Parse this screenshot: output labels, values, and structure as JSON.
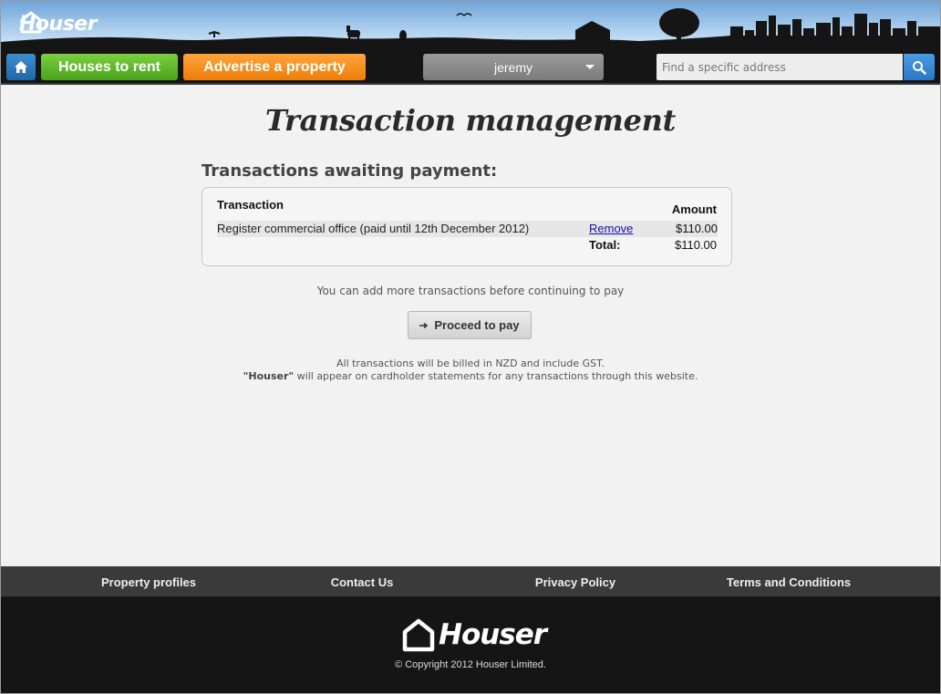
{
  "brand": {
    "name": "Houser"
  },
  "nav": {
    "houses_to_rent": "Houses to rent",
    "advertise": "Advertise a property",
    "user": "jeremy",
    "search_placeholder": "Find a specific address"
  },
  "page": {
    "title": "Transaction management",
    "section_title": "Transactions awaiting payment:"
  },
  "transactions": {
    "header_transaction": "Transaction",
    "header_amount": "Amount",
    "rows": [
      {
        "description": "Register commercial office (paid until 12th December 2012)",
        "action": "Remove",
        "amount": "$110.00"
      }
    ],
    "total_label": "Total:",
    "total_value": "$110.00"
  },
  "notes": {
    "add_more": "You can add more transactions before continuing to pay",
    "proceed": "Proceed to pay",
    "billing_line1": "All transactions will be billed in NZD and include GST.",
    "billing_brand": "\"Houser\"",
    "billing_line2": "will appear on cardholder statements for any transactions through this website."
  },
  "footer": {
    "links": [
      "Property profiles",
      "Contact Us",
      "Privacy Policy",
      "Terms and Conditions"
    ],
    "copyright": "© Copyright 2012 Houser Limited."
  },
  "colors": {
    "home_button": "#2b79bd",
    "green_button": "#5cb82a",
    "orange_button": "#f28a18",
    "search_button": "#3585d3"
  },
  "icons": {
    "home": "home-icon",
    "search": "search-icon",
    "dropdown": "chevron-down-icon",
    "arrow": "arrow-right-icon",
    "logo": "house-outline-icon"
  }
}
